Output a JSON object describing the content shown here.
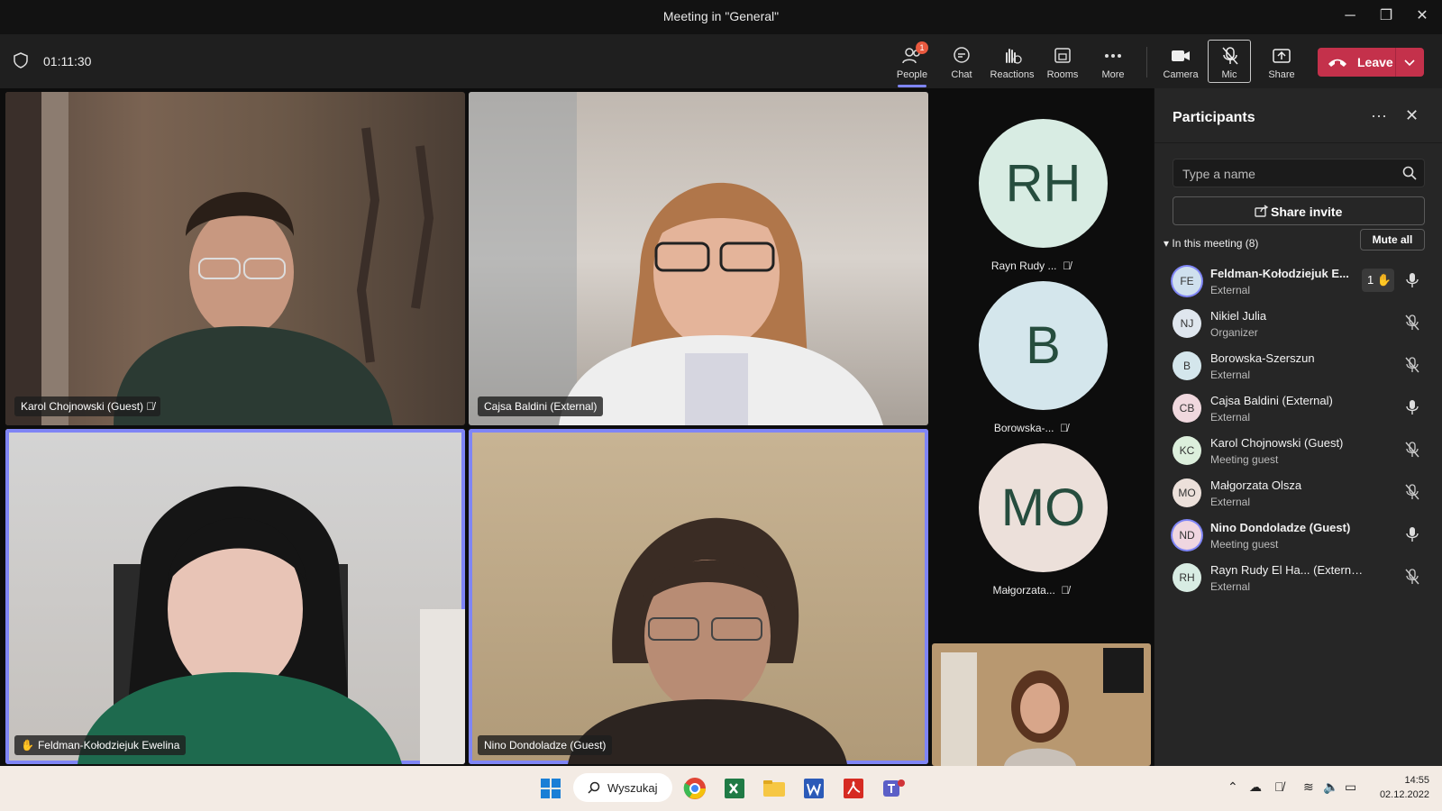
{
  "window": {
    "title": "Meeting in \"General\""
  },
  "toolbar": {
    "timer": "01:11:30",
    "items": [
      {
        "label": "People",
        "badge": "1"
      },
      {
        "label": "Chat"
      },
      {
        "label": "Reactions"
      },
      {
        "label": "Rooms"
      },
      {
        "label": "More"
      },
      {
        "label": "Camera"
      },
      {
        "label": "Mic"
      },
      {
        "label": "Share"
      }
    ],
    "leave_label": "Leave"
  },
  "tiles": [
    {
      "name": "Karol Chojnowski (Guest)",
      "muted": true
    },
    {
      "name": "Cajsa Baldini (External)"
    },
    {
      "name": "Feldman-Kołodziejuk Ewelina",
      "hand_raised": true
    },
    {
      "name": "Nino Dondoladze (Guest)"
    }
  ],
  "avatars": [
    {
      "initials": "RH",
      "name": "Rayn Rudy ...",
      "color": "#d8ece3"
    },
    {
      "initials": "B",
      "name": "Borowska-...",
      "color": "#d4e6ec"
    },
    {
      "initials": "MO",
      "name": "Małgorzata...",
      "color": "#ece0da"
    }
  ],
  "panel": {
    "title": "Participants",
    "search_placeholder": "Type a name",
    "share_invite": "Share invite",
    "in_meeting": "In this meeting (8)",
    "mute_all": "Mute all",
    "participants": [
      {
        "initials": "FE",
        "name": "Feldman-Kołodziejuk E...",
        "role": "External",
        "hand": "1",
        "mic": "on",
        "bold": true,
        "color": "#cfe0ee"
      },
      {
        "initials": "NJ",
        "name": "Nikiel Julia",
        "role": "Organizer",
        "mic": "off",
        "color": "#dfe6ee"
      },
      {
        "initials": "B",
        "name": "Borowska-Szerszun",
        "role": "External",
        "mic": "off",
        "color": "#d4e6ec"
      },
      {
        "initials": "CB",
        "name": "Cajsa Baldini (External)",
        "role": "External",
        "mic": "on",
        "color": "#f0d8de"
      },
      {
        "initials": "KC",
        "name": "Karol Chojnowski (Guest)",
        "role": "Meeting guest",
        "mic": "off",
        "color": "#dcefdc"
      },
      {
        "initials": "MO",
        "name": "Małgorzata Olsza",
        "role": "External",
        "mic": "off",
        "color": "#ece0da"
      },
      {
        "initials": "ND",
        "name": "Nino Dondoladze (Guest)",
        "role": "Meeting guest",
        "mic": "on",
        "bold": true,
        "color": "#efd6e0"
      },
      {
        "initials": "RH",
        "name": "Rayn Rudy El Ha... (External)",
        "role": "External",
        "mic": "off",
        "color": "#d8ece3"
      }
    ]
  },
  "taskbar": {
    "search_label": "Wyszukaj",
    "time": "14:55",
    "date": "02.12.2022"
  },
  "colors": {
    "accent": "#7f85f5",
    "leave": "#c4314b"
  }
}
